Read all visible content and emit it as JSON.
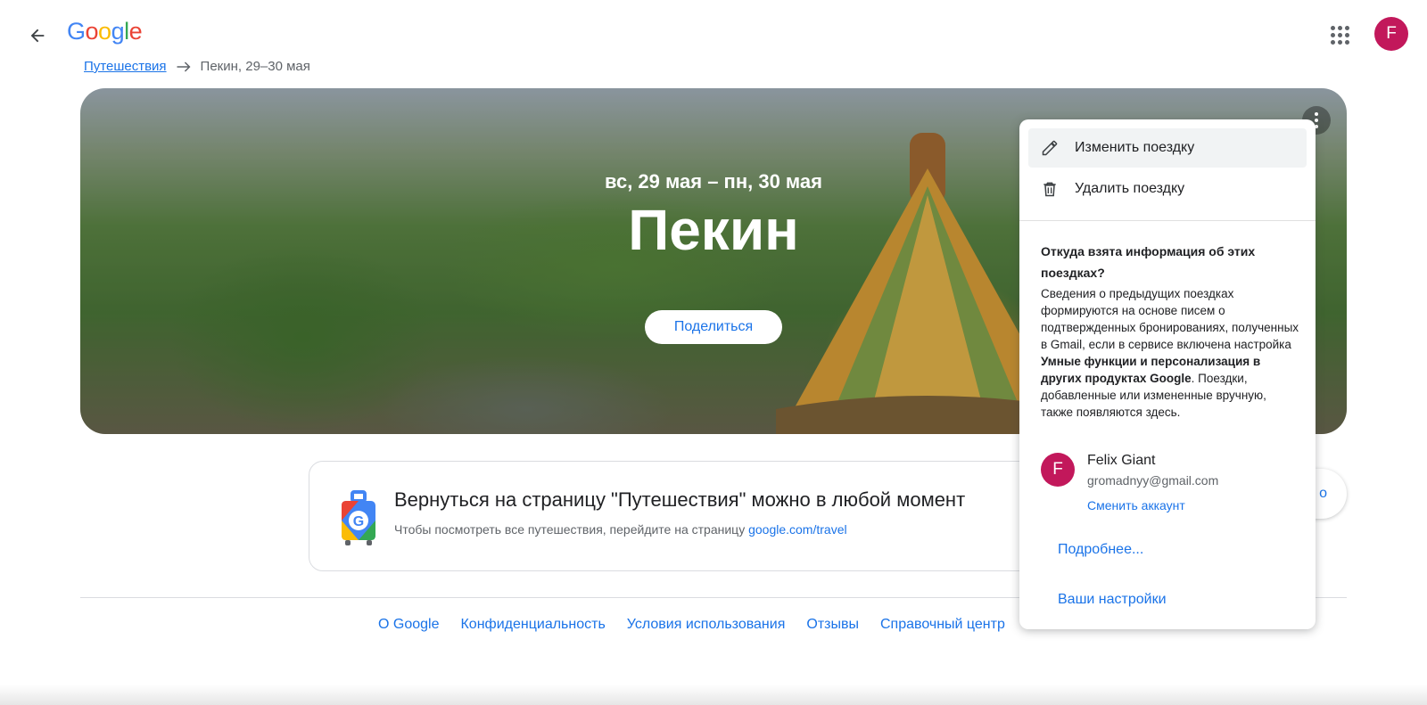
{
  "header": {
    "logo": [
      "G",
      "o",
      "o",
      "g",
      "l",
      "e"
    ],
    "logo_colors": [
      "#4285F4",
      "#EA4335",
      "#FBBC05",
      "#4285F4",
      "#34A853",
      "#EA4335"
    ],
    "avatar_letter": "F",
    "avatar_color": "#c2185b"
  },
  "breadcrumb": {
    "link": "Путешествия",
    "current": "Пекин, 29–30 мая"
  },
  "hero": {
    "dates": "вс, 29 мая – пн, 30 мая",
    "title": "Пекин",
    "share_label": "Поделиться"
  },
  "info_card": {
    "title": "Вернуться на страницу \"Путешествия\" можно в любой момент",
    "subtitle": "Чтобы посмотреть все путешествия, перейдите на страницу ",
    "link": "google.com/travel"
  },
  "partial_button": {
    "label": "о"
  },
  "footer": {
    "links": [
      "О Google",
      "Конфиденциальность",
      "Условия использования",
      "Отзывы",
      "Справочный центр"
    ]
  },
  "menu": {
    "edit_label": "Изменить поездку",
    "delete_label": "Удалить поездку",
    "question": "Откуда взята информация об этих поездках?",
    "text_1": "Сведения о предыдущих поездках формируются на основе писем о подтвержденных бронированиях, полученных в Gmail, если в сервисе включена настройка ",
    "text_bold": "Умные функции и персонализация в других продуктах Google",
    "text_2": ". Поездки, добавленные или измененные вручную, также появляются здесь.",
    "account": {
      "letter": "F",
      "name": "Felix Giant",
      "email": "gromadnyy@gmail.com",
      "switch_label": "Сменить аккаунт"
    },
    "more_label": "Подробнее...",
    "settings_label": "Ваши настройки"
  }
}
